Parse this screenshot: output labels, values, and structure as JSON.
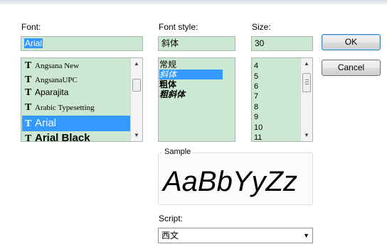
{
  "labels": {
    "font": "Font:",
    "font_style": "Font style:",
    "size": "Size:",
    "sample": "Sample",
    "script": "Script:"
  },
  "font_field_value": "Arial",
  "style_field_value": "斜体",
  "size_field_value": "30",
  "font_list": [
    {
      "name": "Angsana New",
      "selected": false
    },
    {
      "name": "AngsanaUPC",
      "selected": false
    },
    {
      "name": "Aparajita",
      "selected": false
    },
    {
      "name": "Arabic Typesetting",
      "selected": false
    },
    {
      "name": "Arial",
      "selected": true
    },
    {
      "name": "Arial Black",
      "selected": false
    }
  ],
  "font_type_icon": "truetype-icon",
  "style_list": [
    {
      "name": "常规",
      "selected": false
    },
    {
      "name": "斜体",
      "selected": true
    },
    {
      "name": "粗体",
      "selected": false
    },
    {
      "name": "粗斜体",
      "selected": false
    }
  ],
  "size_list": [
    "4",
    "5",
    "6",
    "7",
    "8",
    "9",
    "10",
    "11"
  ],
  "buttons": {
    "ok": "OK",
    "cancel": "Cancel"
  },
  "sample_text": "AaBbYyZz",
  "script_value": "西文",
  "colors": {
    "field_bg": "#cde8d2",
    "selection": "#3399ff"
  }
}
